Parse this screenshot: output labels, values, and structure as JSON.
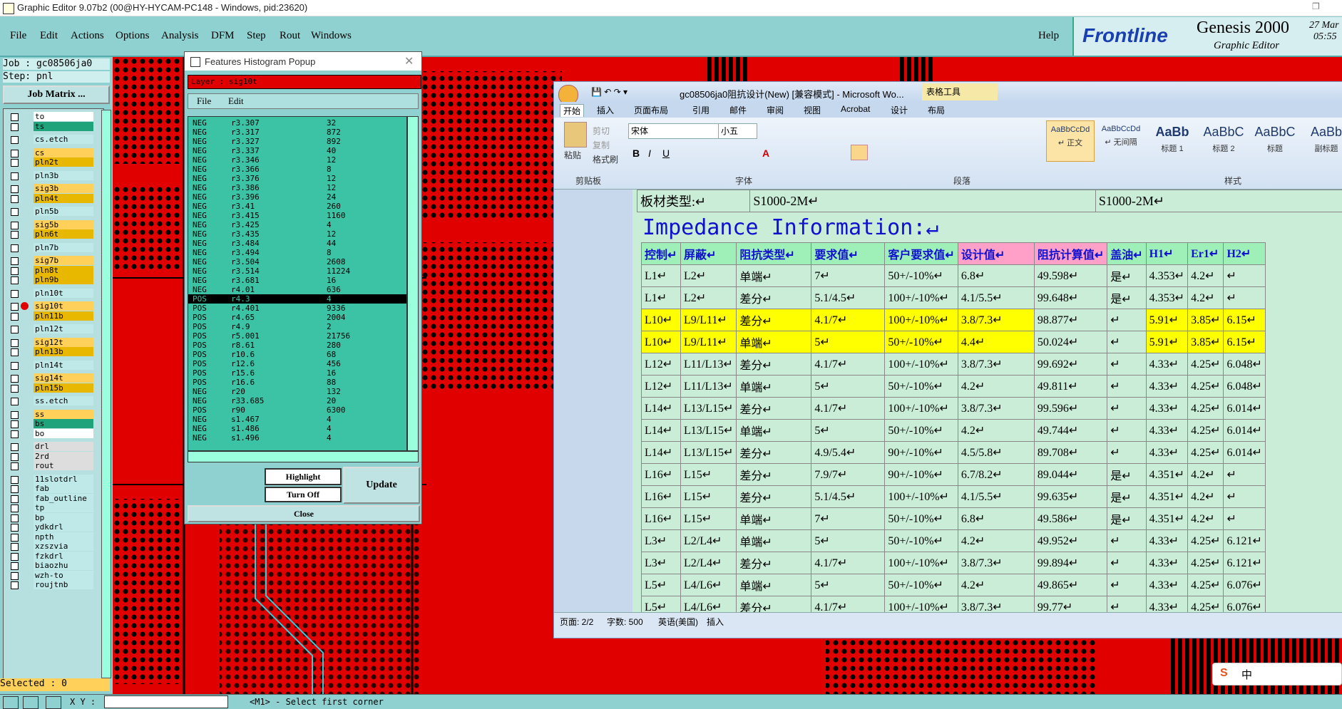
{
  "window_title": "Graphic Editor 9.07b2 (00@HY-HYCAM-PC148 - Windows, pid:23620)",
  "menu": [
    "File",
    "Edit",
    "Actions",
    "Options",
    "Analysis",
    "DFM",
    "Step",
    "Rout",
    "Windows"
  ],
  "help": "Help",
  "brand": {
    "logo": "Frontline",
    "product": "Genesis 2000",
    "sub": "Graphic Editor",
    "date": "27 Mar",
    "time": "05:55"
  },
  "left": {
    "job": "Job : gc08506ja0",
    "step": "Step: pnl",
    "job_matrix": "Job Matrix ...",
    "layers": [
      "to",
      "ts",
      "cs.etch",
      "cs",
      "pln2t",
      "pln3b",
      "sig3b",
      "pln4t",
      "pln5b",
      "sig5b",
      "pln6t",
      "pln7b",
      "sig7b",
      "pln8t",
      "pln9b",
      "pln10t",
      "sig10t",
      "pln11b",
      "pln12t",
      "sig12t",
      "pln13b",
      "pln14t",
      "sig14t",
      "pln15b",
      "ss.etch",
      "ss",
      "bs",
      "bo",
      "drl",
      "2rd",
      "rout",
      "11slotdrl",
      "fab",
      "fab_outline",
      "tp",
      "bp",
      "ydkdrl",
      "npth",
      "xzszvia",
      "fzkdrl",
      "biaozhu",
      "wzh-to",
      "roujtnb"
    ],
    "selected": "Selected : 0"
  },
  "popup": {
    "title": "Features Histogram Popup",
    "layer_label": "Layer :  sig10t",
    "menu": [
      "File",
      "Edit"
    ],
    "rows": [
      [
        "NEG",
        "r3.307",
        "32"
      ],
      [
        "NEG",
        "r3.317",
        "872"
      ],
      [
        "NEG",
        "r3.327",
        "892"
      ],
      [
        "NEG",
        "r3.337",
        "40"
      ],
      [
        "NEG",
        "r3.346",
        "12"
      ],
      [
        "NEG",
        "r3.366",
        "8"
      ],
      [
        "NEG",
        "r3.376",
        "12"
      ],
      [
        "NEG",
        "r3.386",
        "12"
      ],
      [
        "NEG",
        "r3.396",
        "24"
      ],
      [
        "NEG",
        "r3.41",
        "260"
      ],
      [
        "NEG",
        "r3.415",
        "1160"
      ],
      [
        "NEG",
        "r3.425",
        "4"
      ],
      [
        "NEG",
        "r3.435",
        "12"
      ],
      [
        "NEG",
        "r3.484",
        "44"
      ],
      [
        "NEG",
        "r3.494",
        "8"
      ],
      [
        "NEG",
        "r3.504",
        "2608"
      ],
      [
        "NEG",
        "r3.514",
        "11224"
      ],
      [
        "NEG",
        "r3.681",
        "16"
      ],
      [
        "NEG",
        "r4.01",
        "636"
      ],
      [
        "POS",
        "r4.3",
        "4"
      ],
      [
        "POS",
        "r4.401",
        "9336"
      ],
      [
        "POS",
        "r4.65",
        "2004"
      ],
      [
        "POS",
        "r4.9",
        "2"
      ],
      [
        "POS",
        "r5.001",
        "21756"
      ],
      [
        "POS",
        "r8.61",
        "280"
      ],
      [
        "POS",
        "r10.6",
        "68"
      ],
      [
        "POS",
        "r12.6",
        "456"
      ],
      [
        "POS",
        "r15.6",
        "16"
      ],
      [
        "POS",
        "r16.6",
        "88"
      ],
      [
        "NEG",
        "r20",
        "132"
      ],
      [
        "NEG",
        "r33.685",
        "20"
      ],
      [
        "POS",
        "r90",
        "6300"
      ],
      [
        "NEG",
        "s1.467",
        "4"
      ],
      [
        "NEG",
        "s1.486",
        "4"
      ],
      [
        "NEG",
        "s1.496",
        "4"
      ]
    ],
    "highlight": "Highlight",
    "turn_off": "Turn Off",
    "update": "Update",
    "close": "Close"
  },
  "word": {
    "title": "gc08506ja0阻抗设计(New) [兼容模式] - Microsoft Wo...",
    "context_tab": "表格工具",
    "tabs": [
      "开始",
      "插入",
      "页面布局",
      "引用",
      "邮件",
      "审阅",
      "视图",
      "Acrobat",
      "设计",
      "布局"
    ],
    "clipboard": {
      "paste": "粘贴",
      "cut": "剪切",
      "copy": "复制",
      "format": "格式刷",
      "group": "剪贴板"
    },
    "font_name": "宋体",
    "font_size": "小五",
    "font_group": "字体",
    "para_group": "段落",
    "style_group": "样式",
    "styles": [
      [
        "AaBbCcDd",
        "↵ 正文"
      ],
      [
        "AaBbCcDd",
        "↵ 无间隔"
      ],
      [
        "AaBb",
        "标题 1"
      ],
      [
        "AaBbC",
        "标题 2"
      ],
      [
        "AaBbC",
        "标题"
      ],
      [
        "AaBb",
        "副标题"
      ]
    ],
    "board_label": "板材类型:↵",
    "board_val1": "S1000-2M↵",
    "board_val2": "S1000-2M↵",
    "heading": "Impedance Information:↵",
    "headers": [
      "控制↵",
      "屏蔽↵",
      "阻抗类型↵",
      "要求值↵",
      "客户要求值↵",
      "设计值↵",
      "阻抗计算值↵",
      "盖油↵",
      "H1↵",
      "Er1↵",
      "H2↵"
    ],
    "rows": [
      [
        "L1↵",
        "L2↵",
        "单端↵",
        "7↵",
        "50+/-10%↵",
        "6.8↵",
        "49.598↵",
        "是↵",
        "4.353↵",
        "4.2↵",
        "↵"
      ],
      [
        "L1↵",
        "L2↵",
        "差分↵",
        "5.1/4.5↵",
        "100+/-10%↵",
        "4.1/5.5↵",
        "99.648↵",
        "是↵",
        "4.353↵",
        "4.2↵",
        "↵"
      ],
      [
        "L10↵",
        "L9/L11↵",
        "差分↵",
        "4.1/7↵",
        "100+/-10%↵",
        "3.8/7.3↵",
        "98.877↵",
        "↵",
        "5.91↵",
        "3.85↵",
        "6.15↵"
      ],
      [
        "L10↵",
        "L9/L11↵",
        "单端↵",
        "5↵",
        "50+/-10%↵",
        "4.4↵",
        "50.024↵",
        "↵",
        "5.91↵",
        "3.85↵",
        "6.15↵"
      ],
      [
        "L12↵",
        "L11/L13↵",
        "差分↵",
        "4.1/7↵",
        "100+/-10%↵",
        "3.8/7.3↵",
        "99.692↵",
        "↵",
        "4.33↵",
        "4.25↵",
        "6.048↵"
      ],
      [
        "L12↵",
        "L11/L13↵",
        "单端↵",
        "5↵",
        "50+/-10%↵",
        "4.2↵",
        "49.811↵",
        "↵",
        "4.33↵",
        "4.25↵",
        "6.048↵"
      ],
      [
        "L14↵",
        "L13/L15↵",
        "差分↵",
        "4.1/7↵",
        "100+/-10%↵",
        "3.8/7.3↵",
        "99.596↵",
        "↵",
        "4.33↵",
        "4.25↵",
        "6.014↵"
      ],
      [
        "L14↵",
        "L13/L15↵",
        "单端↵",
        "5↵",
        "50+/-10%↵",
        "4.2↵",
        "49.744↵",
        "↵",
        "4.33↵",
        "4.25↵",
        "6.014↵"
      ],
      [
        "L14↵",
        "L13/L15↵",
        "差分↵",
        "4.9/5.4↵",
        "90+/-10%↵",
        "4.5/5.8↵",
        "89.708↵",
        "↵",
        "4.33↵",
        "4.25↵",
        "6.014↵"
      ],
      [
        "L16↵",
        "L15↵",
        "差分↵",
        "7.9/7↵",
        "90+/-10%↵",
        "6.7/8.2↵",
        "89.044↵",
        "是↵",
        "4.351↵",
        "4.2↵",
        "↵"
      ],
      [
        "L16↵",
        "L15↵",
        "差分↵",
        "5.1/4.5↵",
        "100+/-10%↵",
        "4.1/5.5↵",
        "99.635↵",
        "是↵",
        "4.351↵",
        "4.2↵",
        "↵"
      ],
      [
        "L16↵",
        "L15↵",
        "单端↵",
        "7↵",
        "50+/-10%↵",
        "6.8↵",
        "49.586↵",
        "是↵",
        "4.351↵",
        "4.2↵",
        "↵"
      ],
      [
        "L3↵",
        "L2/L4↵",
        "单端↵",
        "5↵",
        "50+/-10%↵",
        "4.2↵",
        "49.952↵",
        "↵",
        "4.33↵",
        "4.25↵",
        "6.121↵"
      ],
      [
        "L3↵",
        "L2/L4↵",
        "差分↵",
        "4.1/7↵",
        "100+/-10%↵",
        "3.8/7.3↵",
        "99.894↵",
        "↵",
        "4.33↵",
        "4.25↵",
        "6.121↵"
      ],
      [
        "L5↵",
        "L4/L6↵",
        "单端↵",
        "5↵",
        "50+/-10%↵",
        "4.2↵",
        "49.865↵",
        "↵",
        "4.33↵",
        "4.25↵",
        "6.076↵"
      ],
      [
        "L5↵",
        "L4/L6↵",
        "差分↵",
        "4.1/7↵",
        "100+/-10%↵",
        "3.8/7.3↵",
        "99.77↵",
        "↵",
        "4.33↵",
        "4.25↵",
        "6.076↵"
      ]
    ],
    "status": {
      "page": "页面: 2/2",
      "words": "字数: 500",
      "lang": "英语(美国)",
      "mode": "插入"
    }
  },
  "bottom": {
    "xy_label": "X Y :",
    "prompt": "<M1> - Select first corner",
    "ime": "中"
  }
}
